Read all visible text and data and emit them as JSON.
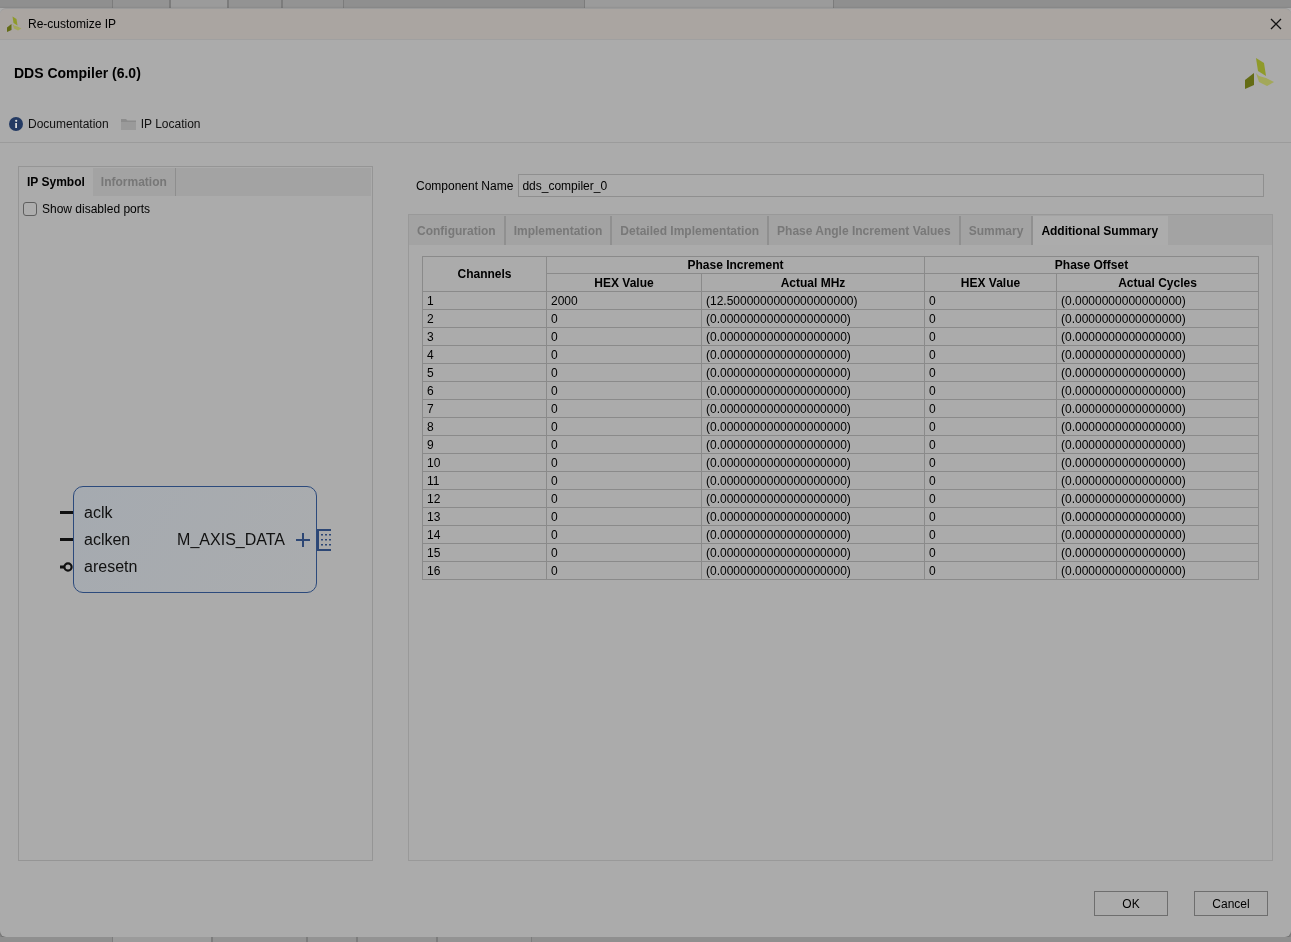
{
  "window": {
    "title": "Re-customize IP"
  },
  "header": {
    "title": "DDS Compiler (6.0)",
    "links": [
      {
        "kind": "info",
        "label": "Documentation"
      },
      {
        "kind": "folder",
        "label": "IP Location"
      }
    ]
  },
  "left_panel": {
    "tabs": [
      {
        "label": "IP Symbol",
        "selected": true
      },
      {
        "label": "Information",
        "selected": false
      }
    ],
    "show_disabled_ports": {
      "label": "Show disabled ports",
      "checked": false
    },
    "symbol": {
      "inputs": [
        {
          "name": "aclk",
          "kind": "plain"
        },
        {
          "name": "aclken",
          "kind": "plain"
        },
        {
          "name": "aresetn",
          "kind": "inverted"
        }
      ],
      "outputs": [
        {
          "name": "M_AXIS_DATA",
          "kind": "bus"
        }
      ]
    }
  },
  "component_name": {
    "label": "Component Name",
    "value": "dds_compiler_0"
  },
  "tabs": [
    {
      "label": "Configuration",
      "selected": false
    },
    {
      "label": "Implementation",
      "selected": false
    },
    {
      "label": "Detailed Implementation",
      "selected": false
    },
    {
      "label": "Phase Angle Increment Values",
      "selected": false
    },
    {
      "label": "Summary",
      "selected": false
    },
    {
      "label": "Additional Summary",
      "selected": true
    }
  ],
  "table": {
    "row_header": "Channels",
    "groups": [
      {
        "label": "Phase Increment",
        "columns": [
          "HEX Value",
          "Actual MHz"
        ]
      },
      {
        "label": "Phase Offset",
        "columns": [
          "HEX Value",
          "Actual Cycles"
        ]
      }
    ],
    "rows": [
      [
        "1",
        "2000",
        "(12.5000000000000000000)",
        "0",
        "(0.0000000000000000)"
      ],
      [
        "2",
        "0",
        "(0.0000000000000000000)",
        "0",
        "(0.0000000000000000)"
      ],
      [
        "3",
        "0",
        "(0.0000000000000000000)",
        "0",
        "(0.0000000000000000)"
      ],
      [
        "4",
        "0",
        "(0.0000000000000000000)",
        "0",
        "(0.0000000000000000)"
      ],
      [
        "5",
        "0",
        "(0.0000000000000000000)",
        "0",
        "(0.0000000000000000)"
      ],
      [
        "6",
        "0",
        "(0.0000000000000000000)",
        "0",
        "(0.0000000000000000)"
      ],
      [
        "7",
        "0",
        "(0.0000000000000000000)",
        "0",
        "(0.0000000000000000)"
      ],
      [
        "8",
        "0",
        "(0.0000000000000000000)",
        "0",
        "(0.0000000000000000)"
      ],
      [
        "9",
        "0",
        "(0.0000000000000000000)",
        "0",
        "(0.0000000000000000)"
      ],
      [
        "10",
        "0",
        "(0.0000000000000000000)",
        "0",
        "(0.0000000000000000)"
      ],
      [
        "11",
        "0",
        "(0.0000000000000000000)",
        "0",
        "(0.0000000000000000)"
      ],
      [
        "12",
        "0",
        "(0.0000000000000000000)",
        "0",
        "(0.0000000000000000)"
      ],
      [
        "13",
        "0",
        "(0.0000000000000000000)",
        "0",
        "(0.0000000000000000)"
      ],
      [
        "14",
        "0",
        "(0.0000000000000000000)",
        "0",
        "(0.0000000000000000)"
      ],
      [
        "15",
        "0",
        "(0.0000000000000000000)",
        "0",
        "(0.0000000000000000)"
      ],
      [
        "16",
        "0",
        "(0.0000000000000000000)",
        "0",
        "(0.0000000000000000)"
      ]
    ]
  },
  "buttons": [
    {
      "label": "OK"
    },
    {
      "label": "Cancel"
    }
  ]
}
